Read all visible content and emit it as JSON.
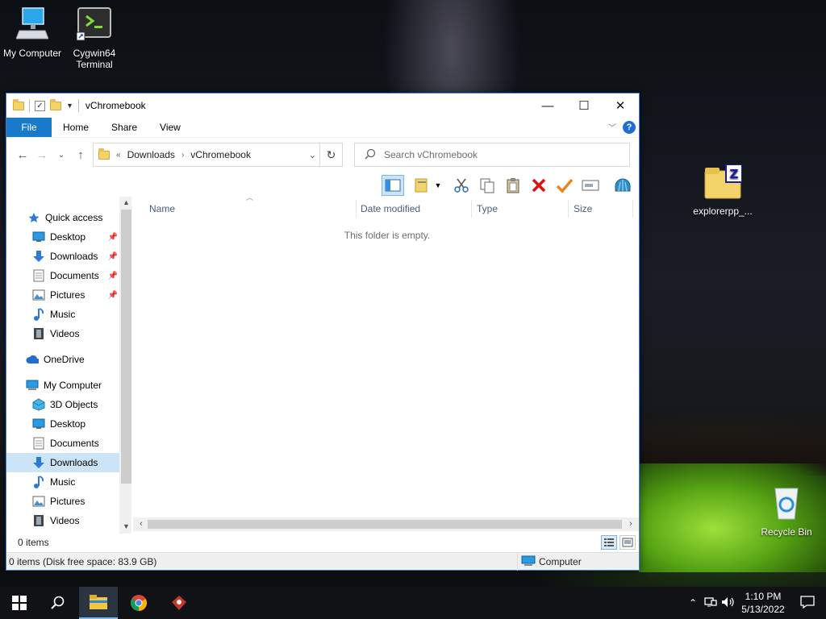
{
  "desktop": {
    "icons": [
      {
        "label": "My Computer",
        "icon": "my-computer-icon"
      },
      {
        "label": "Cygwin64 Terminal",
        "line1": "Cygwin64",
        "line2": "Terminal",
        "icon": "terminal-icon"
      },
      {
        "label": "explorerpp_...",
        "icon": "zip-folder-icon"
      },
      {
        "label": "Recycle Bin",
        "icon": "recycle-bin-icon"
      }
    ]
  },
  "window": {
    "title": "vChromebook",
    "controls": {
      "minimize": "—",
      "maximize": "☐",
      "close": "✕"
    },
    "ribbon": {
      "tabs": [
        "File",
        "Home",
        "Share",
        "View"
      ],
      "help": "?"
    },
    "address": {
      "crumbs": [
        "Downloads",
        "vChromebook"
      ],
      "prefix": "«"
    },
    "search": {
      "placeholder": "Search vChromebook"
    },
    "nav_pane": {
      "quick_access": "Quick access",
      "quick_items": [
        {
          "label": "Desktop",
          "pinned": true
        },
        {
          "label": "Downloads",
          "pinned": true
        },
        {
          "label": "Documents",
          "pinned": true
        },
        {
          "label": "Pictures",
          "pinned": true
        },
        {
          "label": "Music",
          "pinned": false
        },
        {
          "label": "Videos",
          "pinned": false
        }
      ],
      "onedrive": "OneDrive",
      "my_computer": "My Computer",
      "computer_items": [
        "3D Objects",
        "Desktop",
        "Documents",
        "Downloads",
        "Music",
        "Pictures",
        "Videos"
      ],
      "selected": "Downloads"
    },
    "columns": [
      "Name",
      "Date modified",
      "Type",
      "Size"
    ],
    "empty_message": "This folder is empty.",
    "item_count": "0 items",
    "details_status": "0 items (Disk free space: 83.9 GB)",
    "location": "Computer"
  },
  "taskbar": {
    "apps": [
      "start-button",
      "search-button",
      "file-explorer",
      "chrome",
      "app-icon"
    ],
    "time": "1:10 PM",
    "date": "5/13/2022"
  },
  "colors": {
    "accent": "#1979ca",
    "selection": "#cce4f7",
    "taskbar": "#101216"
  }
}
